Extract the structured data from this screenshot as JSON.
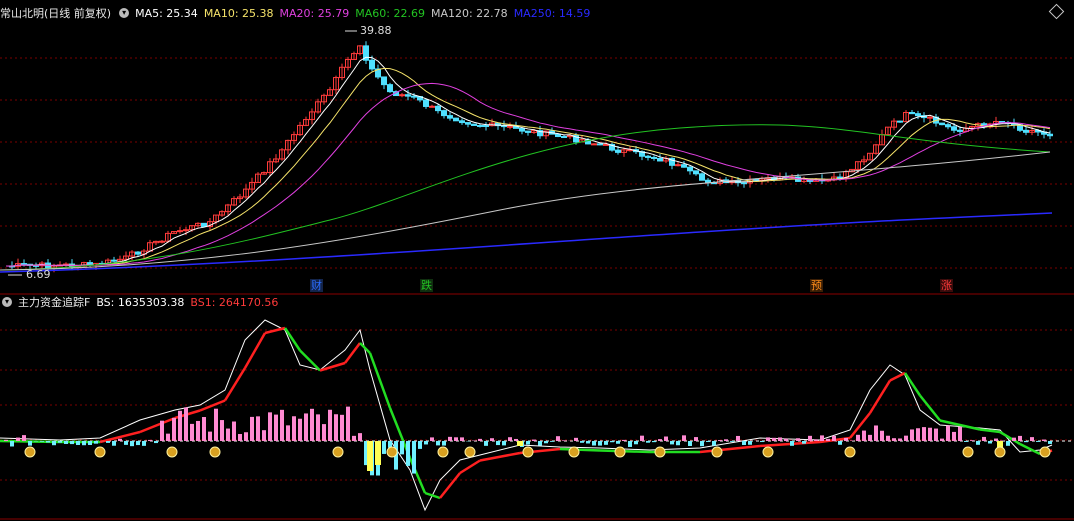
{
  "main_panel": {
    "title": "常山北明(日线 前复权)",
    "dropdown_icon": "chevron-down-icon",
    "ma": [
      {
        "label": "MA5: 25.34",
        "color": "#ffffff"
      },
      {
        "label": "MA10: 25.38",
        "color": "#f5e36a"
      },
      {
        "label": "MA20: 25.79",
        "color": "#e040e0"
      },
      {
        "label": "MA60: 22.69",
        "color": "#22c322"
      },
      {
        "label": "MA120: 22.78",
        "color": "#c8c8c8"
      },
      {
        "label": "MA250: 14.59",
        "color": "#2a2aff"
      }
    ],
    "high_label": "39.88",
    "low_label": "6.69",
    "markers": [
      {
        "text": "财",
        "color": "#2a6cff",
        "bg": "#13244a"
      },
      {
        "text": "跌",
        "color": "#22c322",
        "bg": "#0f2e0f"
      },
      {
        "text": "预",
        "color": "#ff8c1a",
        "bg": "#3a1e05"
      },
      {
        "text": "涨",
        "color": "#ff3a3a",
        "bg": "#3a0b0b"
      }
    ]
  },
  "indicator_panel": {
    "title": "主力资金追踪F",
    "dropdown_icon": "chevron-down-icon",
    "bs_label": "BS: 1635303.38",
    "bs1_label": "BS1: 264170.56",
    "bs_color": "#ffffff",
    "bs1_color": "#ff3a3a"
  },
  "colors": {
    "up": "#ff3b3b",
    "down": "#4fe0ff",
    "grid": "#7a0000",
    "pos_bar": "#ff8ad2",
    "neg_bar": "#6ff0ff",
    "sig_bar": "#ffff55"
  },
  "chart_data": {
    "type": "candlestick",
    "price_max": 39.88,
    "price_min": 6.69,
    "ma_last": {
      "MA5": 25.34,
      "MA10": 25.38,
      "MA20": 25.79,
      "MA60": 22.69,
      "MA120": 22.78,
      "MA250": 14.59
    },
    "indicator_last": {
      "BS": 1635303.38,
      "BS1": 264170.56
    }
  }
}
